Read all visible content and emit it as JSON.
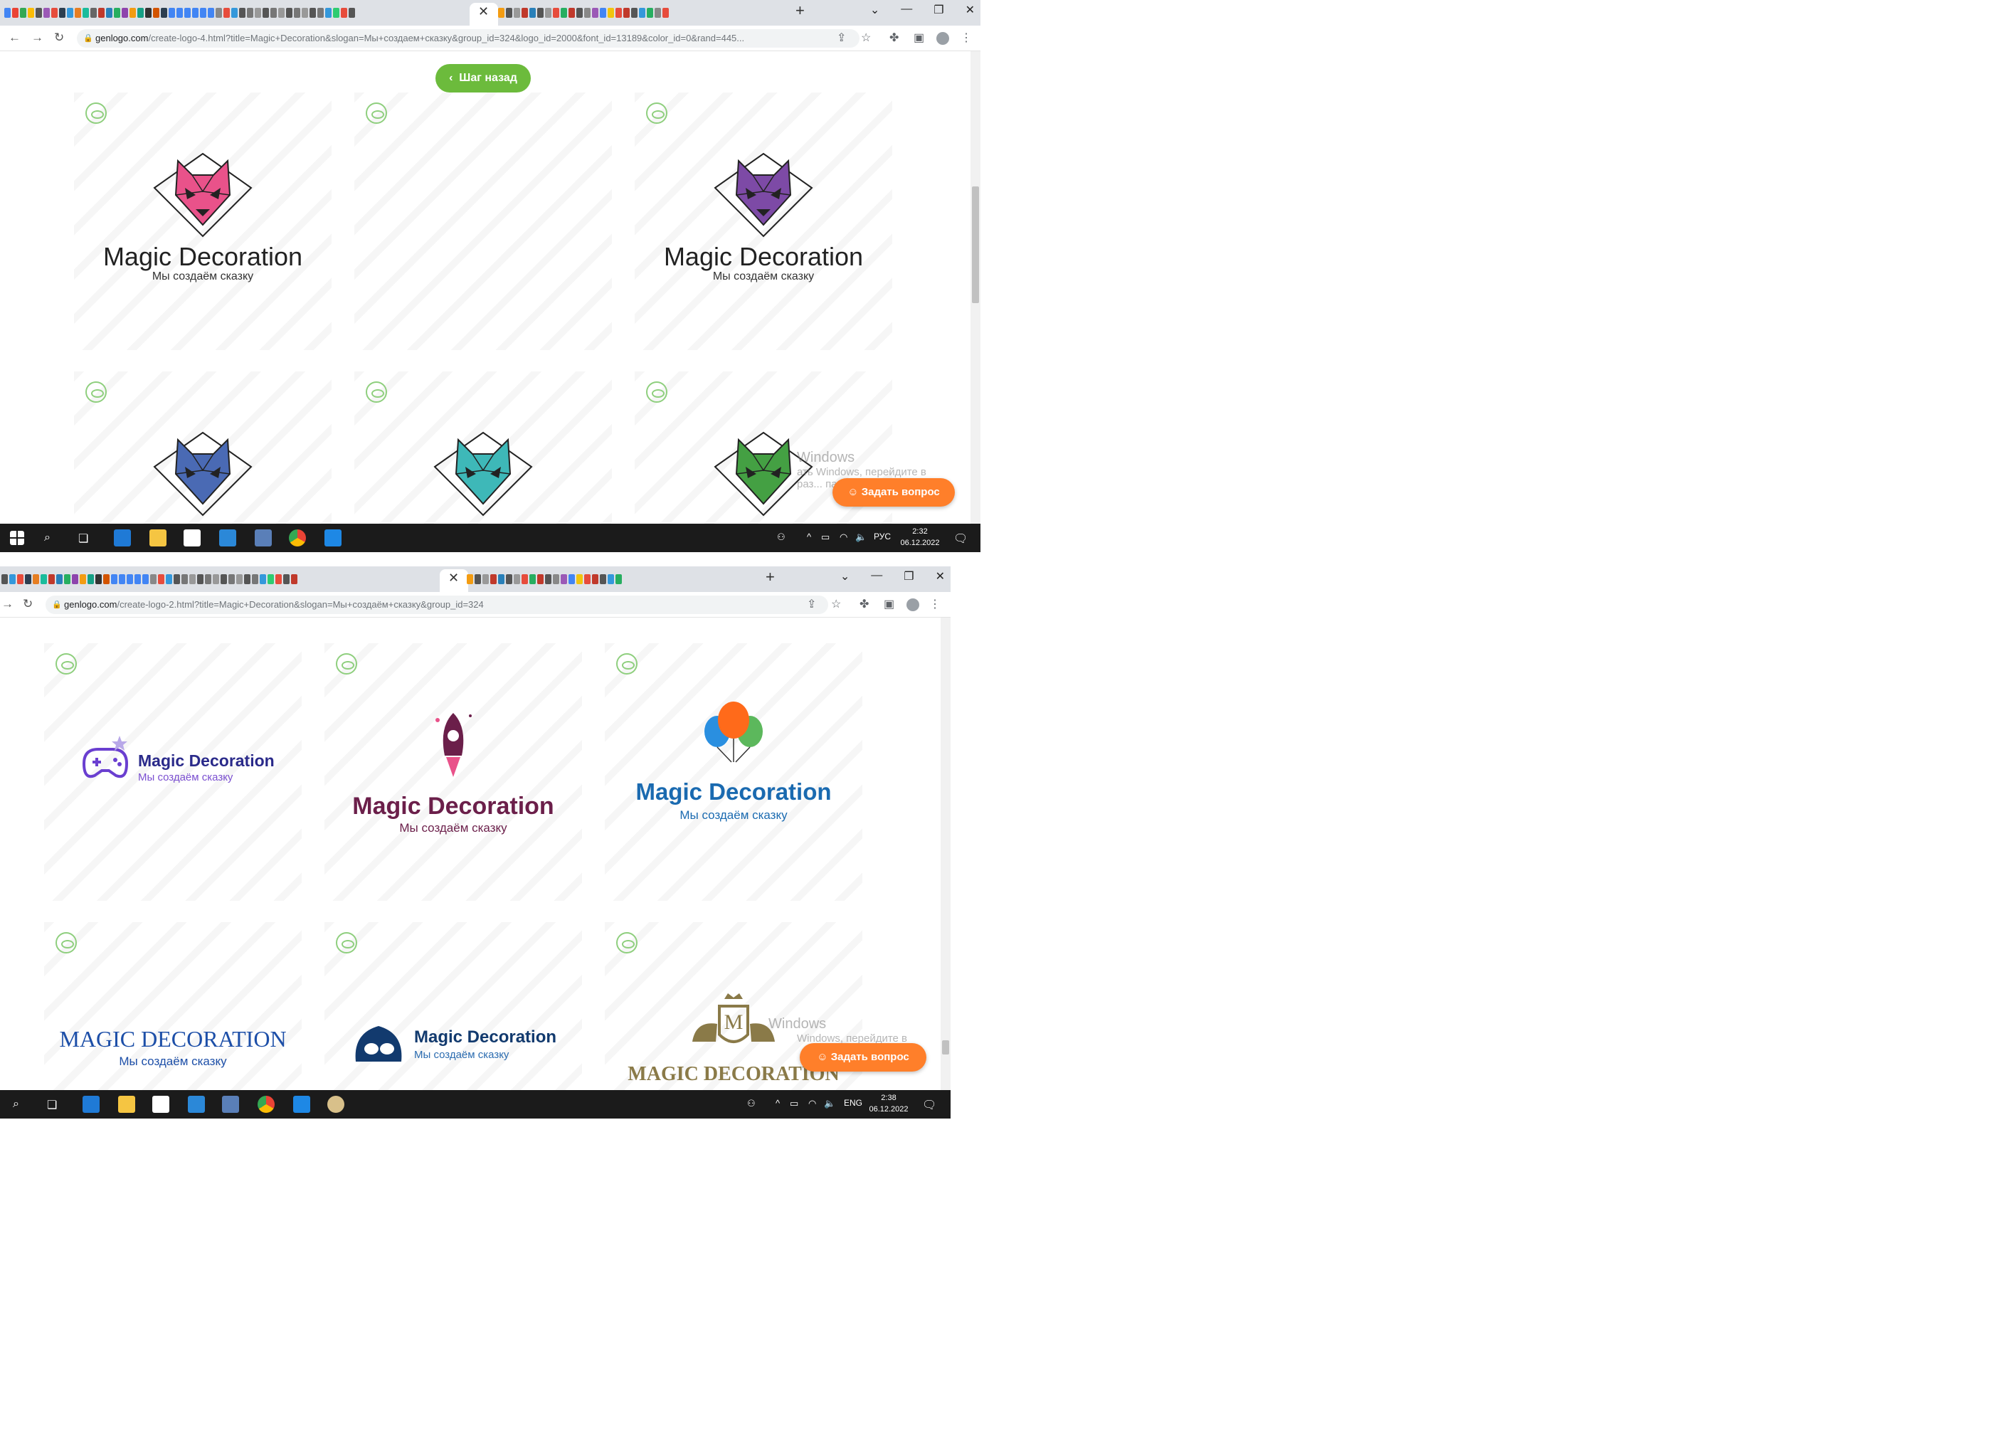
{
  "window1": {
    "url_host": "genlogo.com",
    "url_path": "/create-logo-4.html?title=Magic+Decoration&slogan=Мы+создаем+сказку&group_id=324&logo_id=2000&font_id=13189&color_id=0&rand=445...",
    "back_button": "Шаг назад",
    "cards": [
      {
        "brand": "Magic Decoration",
        "slogan": "Мы создаём сказку",
        "color": "#e9528a"
      },
      {
        "brand": "",
        "slogan": "",
        "color": ""
      },
      {
        "brand": "Magic Decoration",
        "slogan": "Мы создаём сказку",
        "color": "#7d4aa6"
      },
      {
        "brand": "",
        "slogan": "",
        "color": "#4a6ab4"
      },
      {
        "brand": "",
        "slogan": "",
        "color": "#3eb8b8"
      },
      {
        "brand": "",
        "slogan": "",
        "color": "#44a043"
      }
    ],
    "ask_button": "Задать вопрос",
    "watermark_line1": "Windows",
    "watermark_line2": "ать Windows, перейдите в",
    "watermark_line3": "раз... параметры",
    "taskbar": {
      "lang": "РУС",
      "time": "2:32",
      "date": "06.12.2022"
    }
  },
  "window2": {
    "url_host": "genlogo.com",
    "url_path": "/create-logo-2.html?title=Magic+Decoration&slogan=Мы+создаём+сказку&group_id=324",
    "cards": [
      {
        "brand": "Magic Decoration",
        "slogan": "Мы создаём сказку",
        "color": "#2a2a8a",
        "slogan_color": "#7a4fd0"
      },
      {
        "brand": "Magic Decoration",
        "slogan": "Мы создаём сказку",
        "color": "#6b1f4a",
        "slogan_color": "#6b1f4a"
      },
      {
        "brand": "Magic Decoration",
        "slogan": "Мы создаём сказку",
        "color": "#1a6ab0",
        "slogan_color": "#1a6ab0"
      },
      {
        "brand": "MAGIC DECORATION",
        "slogan": "Мы создаём сказку",
        "color": "#1d4fa8",
        "slogan_color": "#1d4fa8"
      },
      {
        "brand": "Magic Decoration",
        "slogan": "Мы создаём сказку",
        "color": "#123a6e",
        "slogan_color": "#2b6cb0"
      },
      {
        "brand": "MAGIC DECORATION",
        "slogan": "",
        "color": "#8a7a48",
        "slogan_color": "#8a7a48"
      }
    ],
    "ask_button": "Задать вопрос",
    "watermark_line1": "Windows",
    "watermark_line2": "Windows, перейдите в",
    "taskbar": {
      "lang": "ENG",
      "time": "2:38",
      "date": "06.12.2022"
    }
  }
}
